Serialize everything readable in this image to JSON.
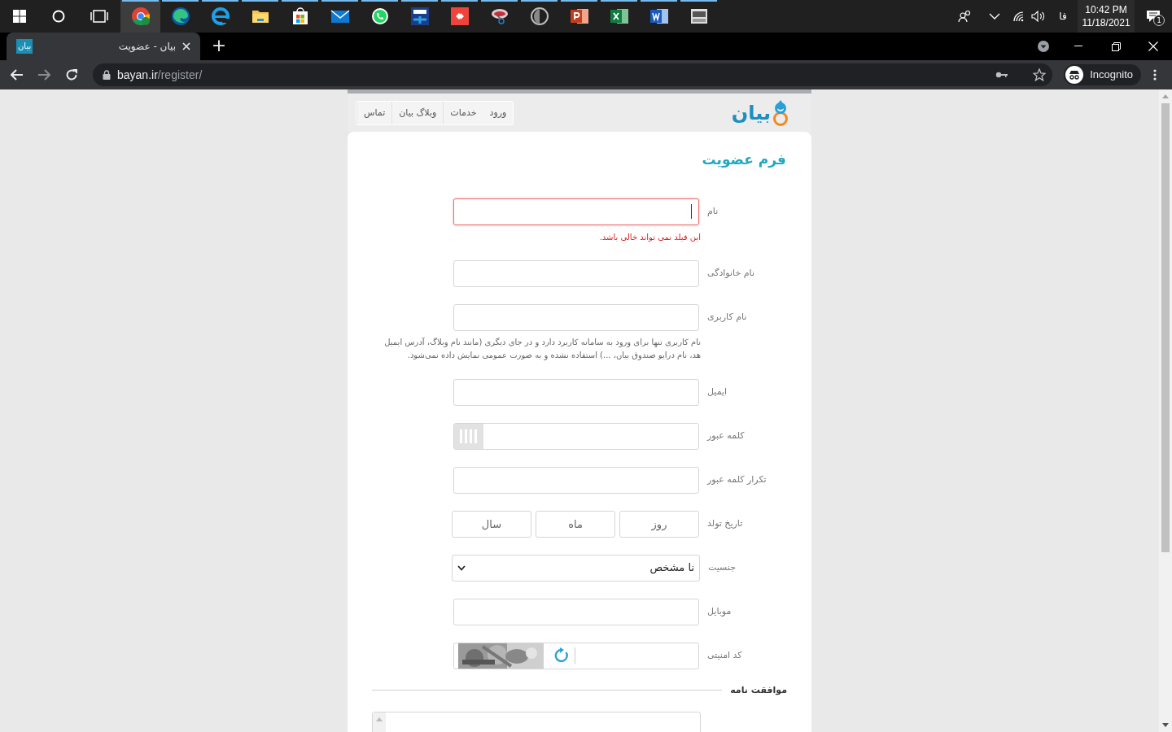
{
  "taskbar": {
    "apps": [
      {
        "kind": "chrome",
        "selected": true
      },
      {
        "kind": "edge",
        "selected": false
      },
      {
        "kind": "ie",
        "selected": false
      },
      {
        "kind": "folder",
        "selected": false
      },
      {
        "kind": "store",
        "selected": false
      },
      {
        "kind": "mail",
        "selected": false
      },
      {
        "kind": "whatsapp",
        "selected": false
      },
      {
        "kind": "dev",
        "selected": false
      },
      {
        "kind": "anydesk",
        "selected": false
      },
      {
        "kind": "snip",
        "selected": false
      },
      {
        "kind": "shield",
        "selected": false
      },
      {
        "kind": "powerpoint",
        "selected": false
      },
      {
        "kind": "excel",
        "selected": false
      },
      {
        "kind": "word",
        "selected": false
      },
      {
        "kind": "device",
        "selected": false
      }
    ],
    "language": "فا",
    "time": "10:42 PM",
    "date": "11/18/2021",
    "notifications": "1"
  },
  "browser": {
    "tab": {
      "favicon": "بیان",
      "title": "بیان - عضویت"
    },
    "new_tab": "+",
    "url_host": "bayan.ir",
    "url_path": "/register/",
    "profile": "Incognito"
  },
  "site": {
    "logo": "بیان",
    "nav": [
      "ورود",
      "خدمات",
      "وبلاگ بیان",
      "تماس"
    ]
  },
  "form": {
    "title": "فرم عضویت",
    "fields": [
      {
        "kind": "text",
        "label": "نام",
        "invalid": true,
        "focused": true,
        "error": "این فیلد نمی تواند خالی باشد."
      },
      {
        "kind": "text",
        "label": "نام خانوادگی",
        "invalid": false,
        "focused": false
      },
      {
        "kind": "text",
        "label": "نام کاربری",
        "invalid": false,
        "focused": false,
        "hint": "نام کاربری تنها برای ورود به سامانه کاربرد دارد و در جای دیگری (مانند نام وبلاگ، آدرس ایمیل هد، نام درایو صندوق بیان، ...) استفاده نشده و به صورت عمومی نمایش داده نمی‌شود."
      },
      {
        "kind": "text",
        "label": "ایمیل",
        "invalid": false,
        "focused": false
      },
      {
        "kind": "password",
        "label": "کلمه عبور",
        "invalid": false,
        "focused": false
      },
      {
        "kind": "text",
        "label": "تکرار کلمه عبور",
        "invalid": false,
        "focused": false
      },
      {
        "kind": "date",
        "label": "تاریخ تولد",
        "parts": [
          "روز",
          "ماه",
          "سال"
        ]
      },
      {
        "kind": "select",
        "label": "جنسیت",
        "value": "نا مشخص"
      },
      {
        "kind": "text",
        "label": "موبایل",
        "invalid": false,
        "focused": false
      },
      {
        "kind": "captcha",
        "label": "کد امنیتی"
      }
    ],
    "agreement": {
      "heading": "موافقت نامه"
    }
  }
}
